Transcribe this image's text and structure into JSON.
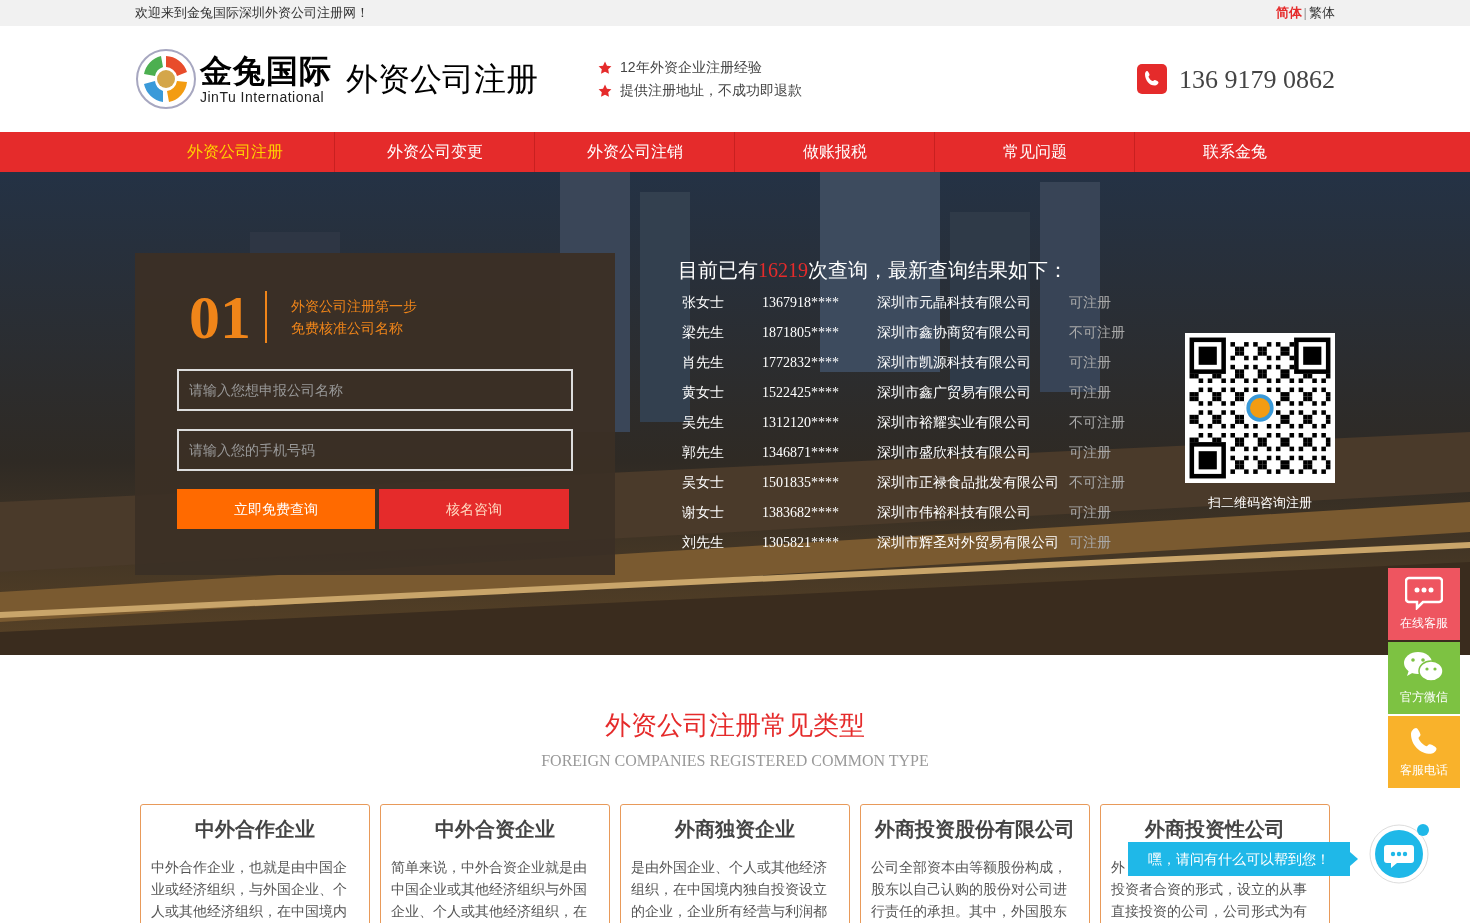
{
  "top_bar": {
    "welcome": "欢迎来到金兔国际深圳外资公司注册网！",
    "languages": [
      {
        "label": "简体",
        "selected": true
      },
      {
        "label": "繁体",
        "selected": false
      }
    ],
    "separator": "|"
  },
  "header": {
    "logo_name": "金兔国际",
    "logo_english": "JinTu International",
    "tagline": "外资公司注册",
    "features": [
      "12年外资企业注册经验",
      "提供注册地址，不成功即退款"
    ],
    "phone": "136 9179 0862"
  },
  "nav": [
    {
      "label": "外资公司注册",
      "selected": true
    },
    {
      "label": "外资公司变更",
      "selected": false
    },
    {
      "label": "外资公司注销",
      "selected": false
    },
    {
      "label": "做账报税",
      "selected": false
    },
    {
      "label": "常见问题",
      "selected": false
    },
    {
      "label": "联系金兔",
      "selected": false
    }
  ],
  "query_form": {
    "step": "01",
    "step_title": "外资公司注册第一步",
    "step_subtitle": "免费核准公司名称",
    "fields": [
      {
        "placeholder": "请输入您想申报公司名称"
      },
      {
        "placeholder": "请输入您的手机号码"
      }
    ],
    "buttons": [
      {
        "label": "立即免费查询",
        "kind": "primary"
      },
      {
        "label": "核名咨询",
        "kind": "secondary"
      }
    ]
  },
  "results": {
    "heading_before": "目前已有",
    "count": "16219",
    "heading_after": "次查询，最新查询结果如下：",
    "rows": [
      {
        "name": "张女士",
        "phone": "1367918****",
        "company": "深圳市元晶科技有限公司",
        "status": "可注册"
      },
      {
        "name": "梁先生",
        "phone": "1871805****",
        "company": "深圳市鑫协商贸有限公司",
        "status": "不可注册"
      },
      {
        "name": "肖先生",
        "phone": "1772832****",
        "company": "深圳市凯源科技有限公司",
        "status": "可注册"
      },
      {
        "name": "黄女士",
        "phone": "1522425****",
        "company": "深圳市鑫广贸易有限公司",
        "status": "可注册"
      },
      {
        "name": "吴先生",
        "phone": "1312120****",
        "company": "深圳市裕耀实业有限公司",
        "status": "不可注册"
      },
      {
        "name": "郭先生",
        "phone": "1346871****",
        "company": "深圳市盛欣科技有限公司",
        "status": "可注册"
      },
      {
        "name": "吴女士",
        "phone": "1501835****",
        "company": "深圳市正禄食品批发有限公司",
        "status": "不可注册"
      },
      {
        "name": "谢女士",
        "phone": "1383682****",
        "company": "深圳市伟裕科技有限公司",
        "status": "可注册"
      },
      {
        "name": "刘先生",
        "phone": "1305821****",
        "company": "深圳市辉圣对外贸易有限公司",
        "status": "可注册"
      }
    ]
  },
  "qr": {
    "caption": "扫二维码咨询注册"
  },
  "section": {
    "title": "外资公司注册常见类型",
    "subtitle": "FOREIGN COMPANIES REGISTERED COMMON TYPE",
    "cards": [
      {
        "title": "中外合作企业",
        "lines": [
          "中外合作企业，也就是由中国企",
          "业或经济组织，与外国企业、个",
          "人或其他经济组织，在中国境内"
        ]
      },
      {
        "title": "中外合资企业",
        "lines": [
          "简单来说，中外合资企业就是由",
          "中国企业或其他经济组织与外国",
          "企业、个人或其他经济组织，在"
        ]
      },
      {
        "title": "外商独资企业",
        "lines": [
          "是由外国企业、个人或其他经济",
          "组织，在中国境内独自投资设立",
          "的企业，企业所有经营与利润都"
        ]
      },
      {
        "title": "外商投资股份有限公司",
        "lines": [
          "公司全部资本由等额股份构成，",
          "股东以自己认购的股份对公司进",
          "行责任的承担。其中，外国股东"
        ]
      },
      {
        "title": "外商投资性公司",
        "lines": [
          "外",
          "投资者合资的形式，设立的从事",
          "直接投资的公司，公司形式为有"
        ]
      }
    ]
  },
  "float_bar": [
    {
      "label": "在线客服",
      "kind": "chat",
      "color": "#ee5560"
    },
    {
      "label": "官方微信",
      "kind": "wechat",
      "color": "#7dc242"
    },
    {
      "label": "客服电话",
      "kind": "phone",
      "color": "#f9b22b"
    }
  ],
  "chat_bubble": {
    "text": "嘿，请问有什么可以帮到您！"
  }
}
